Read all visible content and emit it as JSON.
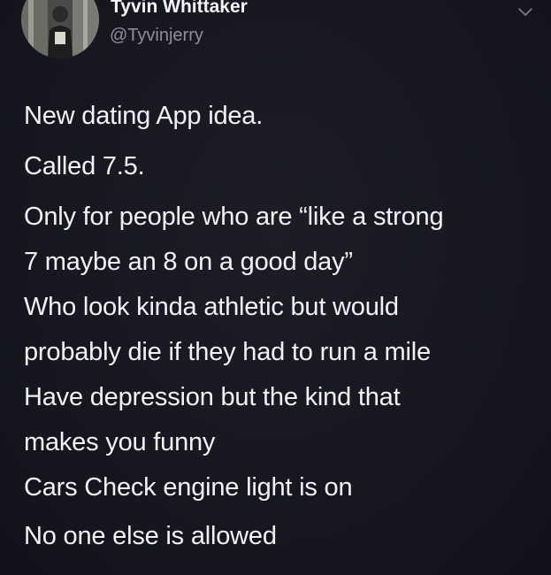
{
  "tweet": {
    "author": {
      "display_name": "Tyvin Whittaker",
      "handle": "@Tyvinjerry",
      "avatar_icon": "profile-photo"
    },
    "more_icon": "chevron-down-icon",
    "paragraphs": [
      {
        "lines": [
          "New dating App idea."
        ]
      },
      {
        "lines": [
          "Called 7.5."
        ]
      },
      {
        "lines": [
          "Only for people who are “like a strong",
          "7 maybe an 8 on a good day”",
          "Who look kinda athletic but would",
          "probably die if they had to run a mile",
          "Have depression but the kind that",
          "makes you funny",
          "Cars Check engine light is on"
        ]
      },
      {
        "lines": [
          "No one else is allowed"
        ]
      }
    ]
  },
  "colors": {
    "background": "#15161f",
    "text": "#f2f2f4",
    "secondary_text": "#8e9099"
  }
}
